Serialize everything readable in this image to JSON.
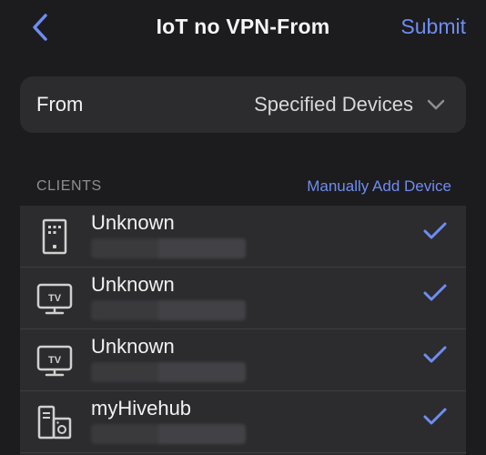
{
  "nav": {
    "title": "IoT no VPN-From",
    "submit_label": "Submit"
  },
  "from": {
    "label": "From",
    "value": "Specified Devices"
  },
  "clients_section": {
    "title": "CLIENTS",
    "add_link": "Manually Add Device"
  },
  "clients": [
    {
      "name": "Unknown",
      "icon": "smart-panel-icon",
      "checked": true
    },
    {
      "name": "Unknown",
      "icon": "tv-icon",
      "checked": true
    },
    {
      "name": "Unknown",
      "icon": "tv-icon",
      "checked": true
    },
    {
      "name": "myHivehub",
      "icon": "hub-icon",
      "checked": true
    }
  ],
  "icon_labels": {
    "tv": "TV"
  },
  "colors": {
    "accent": "#6f8cf2",
    "background": "#1c1c1e",
    "card": "#2c2c2e",
    "secondary_text": "#8e8e93"
  }
}
